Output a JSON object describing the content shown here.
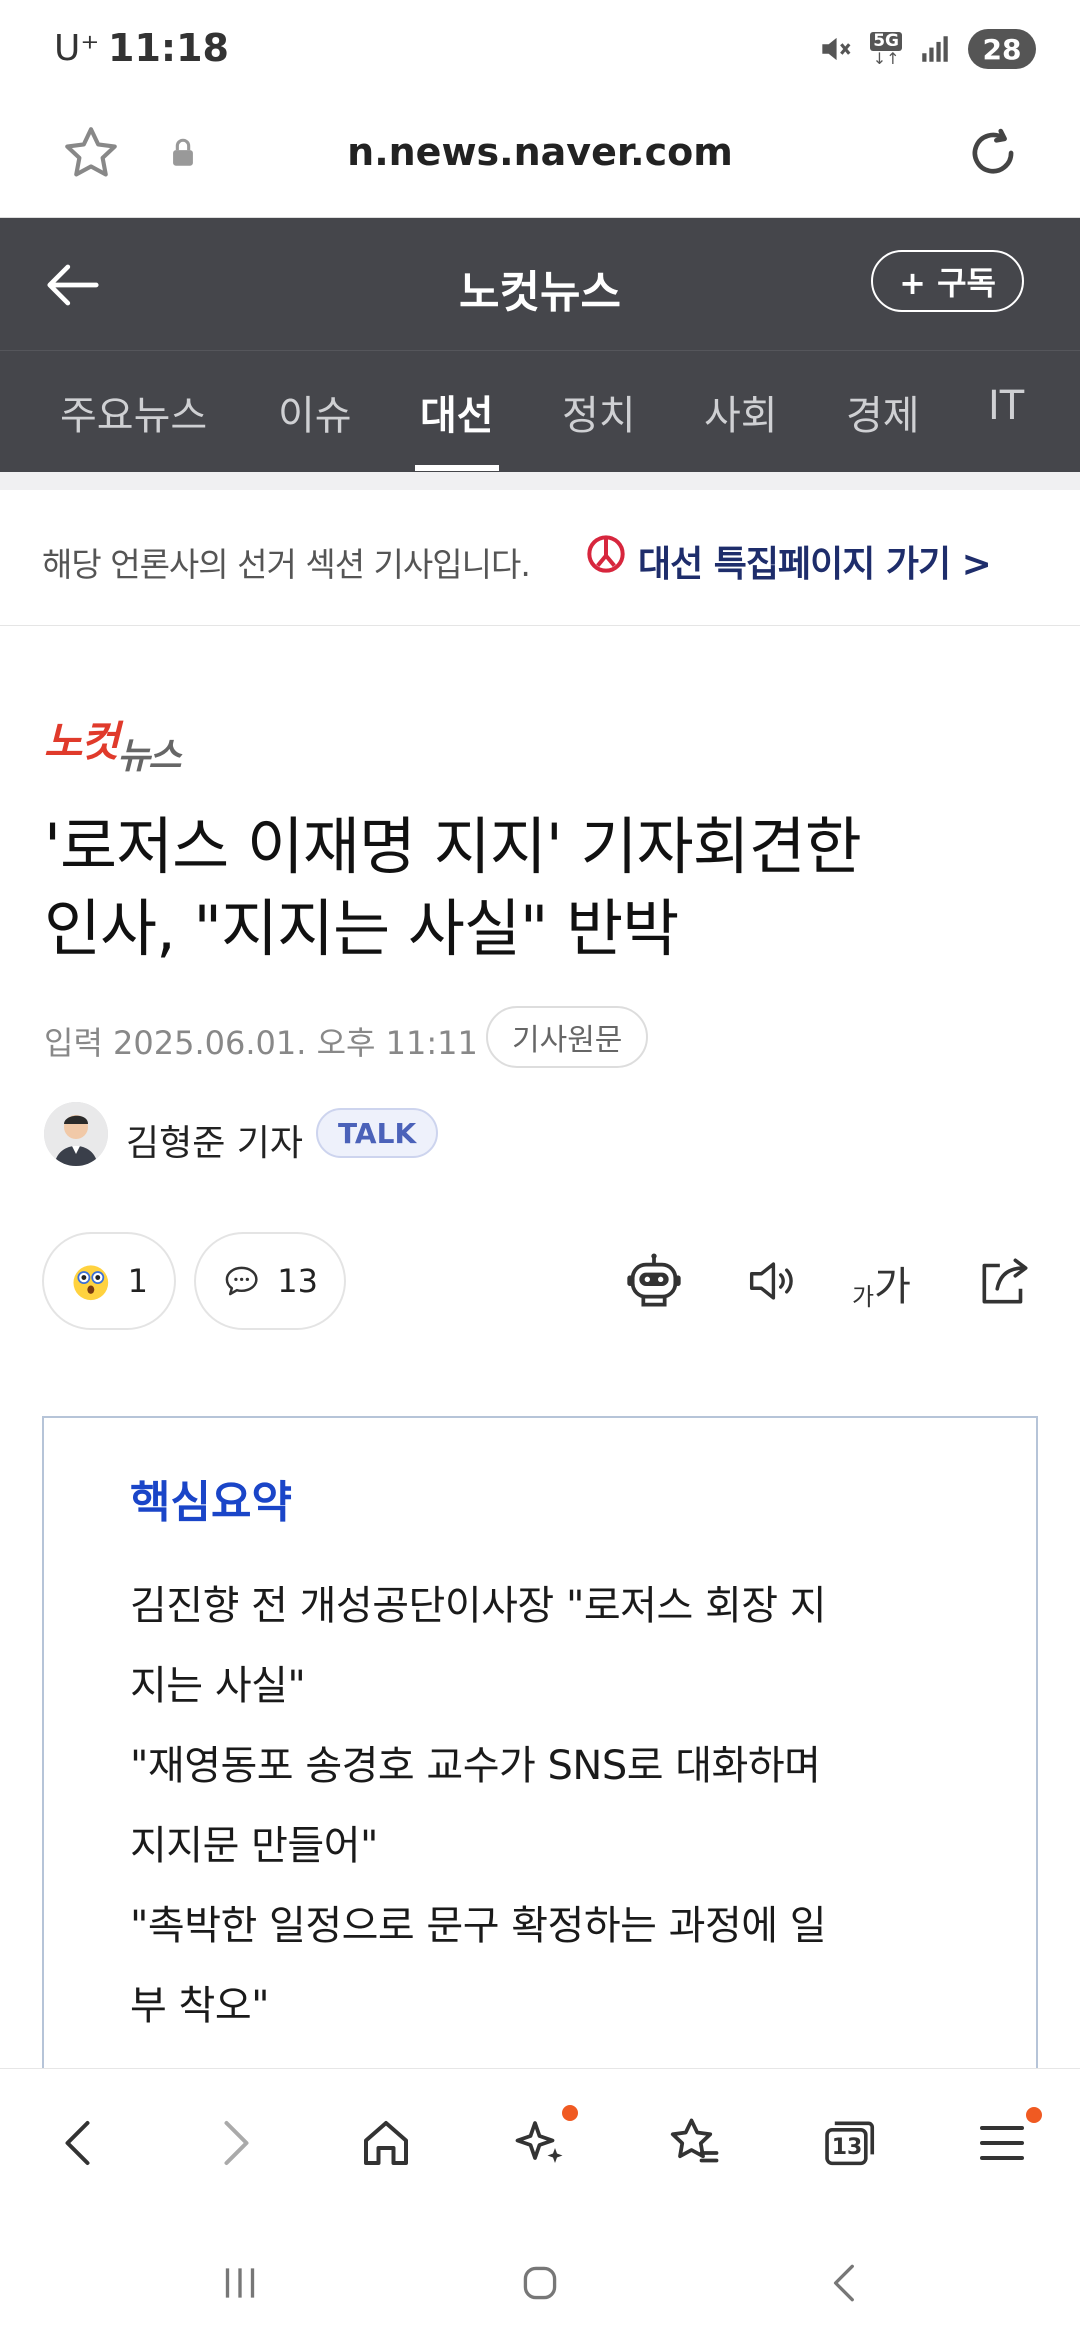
{
  "status_bar": {
    "carrier": "U⁺",
    "time": "11:18",
    "network": "5G",
    "battery": "28"
  },
  "url_bar": {
    "url": "n.news.naver.com"
  },
  "press_header": {
    "title": "노컷뉴스",
    "subscribe_label": "+ 구독"
  },
  "tabs": [
    {
      "label": "주요뉴스"
    },
    {
      "label": "이슈"
    },
    {
      "label": "대선"
    },
    {
      "label": "정치"
    },
    {
      "label": "사회"
    },
    {
      "label": "경제"
    },
    {
      "label": "IT"
    }
  ],
  "active_tab": "대선",
  "banner": {
    "text": "해당 언론사의 선거 섹션 기사입니다.",
    "link": "대선 특집페이지 가기 >"
  },
  "article": {
    "press_logo_red": "노컷",
    "press_logo_gray": "뉴스",
    "headline_line1": "'로저스 이재명 지지' 기자회견한",
    "headline_line2": "인사, \"지지는 사실\" 반박",
    "date": "입력 2025.06.01. 오후 11:11",
    "original_label": "기사원문",
    "author": "김형준 기자",
    "talk_label": "TALK"
  },
  "reactions": {
    "emoji_count": "1",
    "comment_count": "13",
    "font_size_label_small": "가",
    "font_size_label_large": "가"
  },
  "summary": {
    "title": "핵심요약",
    "lines": [
      "김진향 전 개성공단이사장 \"로저스 회장 지",
      "지는 사실\"",
      "\"재영동포 송경호 교수가 SNS로 대화하며",
      "지지문 만들어\"",
      "\"촉박한 일정으로 문구 확정하는 과정에 일",
      "부 착오\""
    ]
  },
  "bottom_nav": {
    "tab_count": "13"
  },
  "colors": {
    "header_bg": "#45464b",
    "summary_title": "#1a45c8",
    "banner_link": "#1e2d6b",
    "logo_red": "#e03a2b",
    "notification_dot": "#f05a22"
  }
}
